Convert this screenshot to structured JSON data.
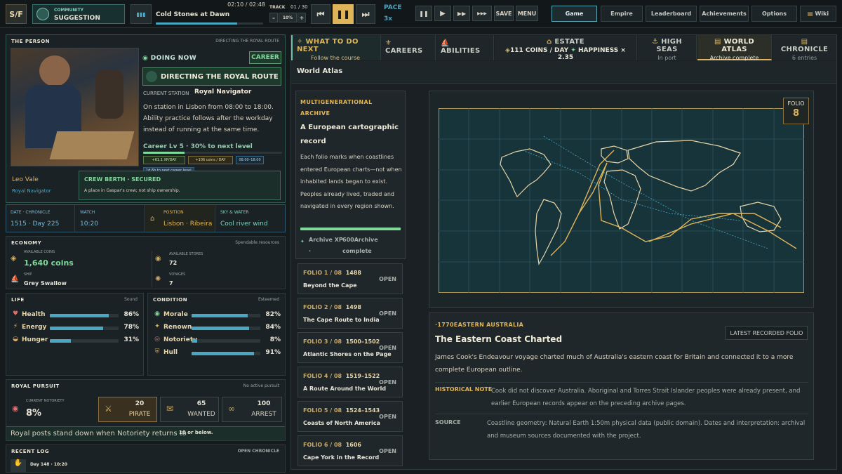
{
  "topbar": {
    "logo": "S/F",
    "community_label": "COMMUNITY",
    "community_value": "SUGGESTION",
    "music_time": "02:10 / 02:48",
    "music_title": "Cold Stones at Dawn",
    "music_progress": 0.76,
    "track_label": "TRACK",
    "track_value": "01 / 30",
    "volume_minus": "–",
    "volume_value": "10%",
    "volume_plus": "+",
    "pace_label": "PACE",
    "pace_value": "3x",
    "save": "SAVE",
    "menu": "MENU",
    "tabs": [
      "Game",
      "Empire",
      "Leaderboard",
      "Achievements",
      "Options",
      "Wiki"
    ]
  },
  "person": {
    "title": "THE PERSON",
    "right": "DIRECTING THE ROYAL ROUTE",
    "name": "Leo Vale",
    "role": "Royal Navigator",
    "doing_now": "DOING NOW",
    "career_badge": "CAREER",
    "activity": "DIRECTING THE ROYAL ROUTE",
    "station_label": "CURRENT STATION",
    "station_value": "Royal Navigator",
    "desc": "On station in Lisbon from 08:00 to 18:00. Ability practice follows after the workday instead of running at the same time.",
    "career_level": "Career Lv 5 · 30% to next level",
    "chip_xp": "+61.1 XP/DAY",
    "chip_coins": "+106 coins / DAY",
    "chip_time": "08:00–18:00",
    "tooltip": "1d 6h to next career level",
    "crew_title": "CREW BERTH · SECURED",
    "crew_desc": "A place in Gaspar's crew; not ship ownership."
  },
  "info": {
    "date_label": "DATE · CHRONICLE",
    "date_value": "1515 · Day 225",
    "watch_label": "WATCH",
    "watch_value": "10:20",
    "position_label": "POSITION",
    "position_value": "Lisbon · Ribeira",
    "sky_label": "SKY & WATER",
    "sky_value": "Cool river wind"
  },
  "economy": {
    "title": "ECONOMY",
    "right": "Spendable resources",
    "coins_label": "AVAILABLE COINS",
    "coins_value": "1,640 coins",
    "stores_label": "AVAILABLE STORES",
    "stores_value": "72",
    "ship_label": "SHIP",
    "ship_value": "Grey Swallow",
    "voyages_label": "VOYAGES",
    "voyages_value": "7"
  },
  "life": {
    "title": "LIFE",
    "right": "Sound",
    "stats": [
      {
        "label": "Health",
        "value": "86%",
        "fill": 0.86
      },
      {
        "label": "Energy",
        "value": "78%",
        "fill": 0.78
      },
      {
        "label": "Hunger",
        "value": "31%",
        "fill": 0.31
      }
    ]
  },
  "condition": {
    "title": "CONDITION",
    "right": "Esteemed",
    "stats": [
      {
        "label": "Morale",
        "value": "82%",
        "fill": 0.82
      },
      {
        "label": "Renown",
        "value": "84%",
        "fill": 0.84
      },
      {
        "label": "Notoriety",
        "value": "8%",
        "fill": 0.08
      },
      {
        "label": "Hull",
        "value": "91%",
        "fill": 0.91
      }
    ]
  },
  "pursuit": {
    "title": "ROYAL PURSUIT",
    "right": "No active pursuit",
    "notoriety_label": "CURRENT NOTORIETY",
    "notoriety_value": "8%",
    "tiers": [
      {
        "num": "20",
        "label": "PIRATE"
      },
      {
        "num": "65",
        "label": "WANTED"
      },
      {
        "num": "100",
        "label": "ARREST"
      }
    ],
    "note": "Royal posts stand down when Notoriety returns to",
    "note_bold": "10 or below."
  },
  "log": {
    "title": "RECENT LOG",
    "right": "OPEN CHRONICLE",
    "entry": "Day 148 · 10:20"
  },
  "rtabs": [
    {
      "title": "WHAT TO DO NEXT",
      "sub": "Follow the course"
    },
    {
      "title": "CAREERS",
      "sub": ""
    },
    {
      "title": "ABILITIES",
      "sub": ""
    },
    {
      "title": "ESTATE",
      "sub": "111 COINS / DAY",
      "sub2": "HAPPINESS × 2.35"
    },
    {
      "title": "HIGH SEAS",
      "sub": "In port"
    },
    {
      "title": "WORLD ATLAS",
      "sub": "Archive complete"
    },
    {
      "title": "CHRONICLE",
      "sub": "6 entries"
    }
  ],
  "atlas": {
    "heading": "World Atlas",
    "archive_label": "MULTIGENERATIONAL ARCHIVE",
    "archive_title": "A European cartographic record",
    "archive_desc": "Each folio marks when coastlines entered European charts—not when inhabited lands began to exist. Peoples already lived, traded and navigated in every region shown.",
    "archive_xp_label": "Archive XP ·",
    "archive_xp_value": "600Archive complete",
    "folios": [
      {
        "num": "FOLIO 1 / 08",
        "year": "1488",
        "title": "Beyond the Cape",
        "status": "OPEN"
      },
      {
        "num": "FOLIO 2 / 08",
        "year": "1498",
        "title": "The Cape Route to India",
        "status": "OPEN"
      },
      {
        "num": "FOLIO 3 / 08",
        "year": "1500–1502",
        "title": "Atlantic Shores on the Page",
        "status": "OPEN"
      },
      {
        "num": "FOLIO 4 / 08",
        "year": "1519–1522",
        "title": "A Route Around the World",
        "status": "OPEN"
      },
      {
        "num": "FOLIO 5 / 08",
        "year": "1524–1543",
        "title": "Coasts of North America",
        "status": "OPEN"
      },
      {
        "num": "FOLIO 6 / 08",
        "year": "1606",
        "title": "Cape York in the Record",
        "status": "OPEN"
      }
    ],
    "folio_badge_label": "FOLIO",
    "folio_badge_value": "8",
    "detail_eyebrow": "·1770EASTERN AUSTRALIA",
    "latest_btn": "LATEST RECORDED FOLIO",
    "detail_title": "The Eastern Coast Charted",
    "detail_desc": "James Cook's Endeavour voyage charted much of Australia's eastern coast for Britain and connected it to a more complete European outline.",
    "note_label": "HISTORICAL NOTE",
    "note_text": "Cook did not discover Australia. Aboriginal and Torres Strait Islander peoples were already present, and earlier European records appear on the preceding archive pages.",
    "source_label": "SOURCE",
    "source_text": "Coastline geometry: Natural Earth 1:50m physical data (public domain). Dates and interpretation: archival and museum sources documented with the project."
  },
  "colors": {
    "accent": "#e0b55a",
    "teal": "#4aa7c4",
    "green": "#7fd99a",
    "map_bg": "#17343b"
  }
}
